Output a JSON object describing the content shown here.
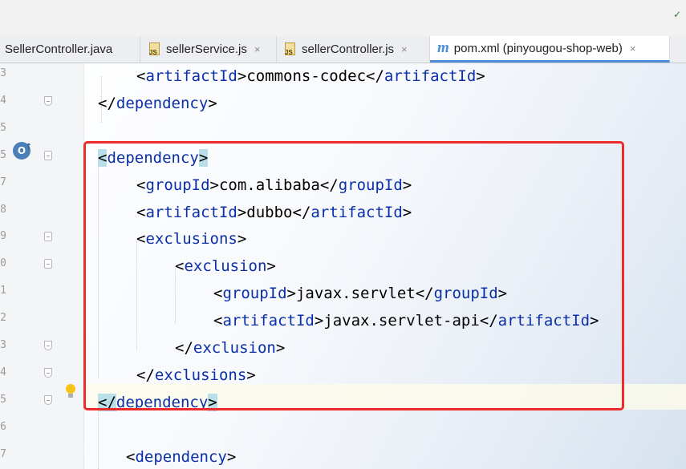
{
  "window": {
    "control_glyph": "✓"
  },
  "tabs": [
    {
      "label": "SellerController.java",
      "icon": "java-class-icon",
      "closable": false
    },
    {
      "label": "sellerService.js",
      "icon": "js-file-icon",
      "closable": true
    },
    {
      "label": "sellerController.js",
      "icon": "js-file-icon",
      "closable": true
    },
    {
      "label": "pom.xml (pinyougou-shop-web)",
      "icon": "maven-icon",
      "closable": true,
      "active": true
    }
  ],
  "tab_icon_text": {
    "js": "JS",
    "maven": "m"
  },
  "close_glyph": "×",
  "gutter": {
    "line_numbers": [
      "3",
      "4",
      "5",
      "5",
      "7",
      "8",
      "9",
      "0",
      "1",
      "2",
      "3",
      "4",
      "5",
      "6",
      "7"
    ],
    "override_glyph": "O",
    "override_arrow": "↑"
  },
  "code": [
    {
      "open": "<",
      "name": "artifactId",
      "close": ">",
      "text": "commons-codec",
      "end_open": "</",
      "end_name": "artifactId",
      "end_close": ">"
    },
    {
      "open": "</",
      "name": "dependency",
      "close": ">"
    },
    {},
    {
      "open": "<",
      "name": "dependency",
      "close": ">"
    },
    {
      "open": "<",
      "name": "groupId",
      "close": ">",
      "text": "com.alibaba",
      "end_open": "</",
      "end_name": "groupId",
      "end_close": ">"
    },
    {
      "open": "<",
      "name": "artifactId",
      "close": ">",
      "text": "dubbo",
      "end_open": "</",
      "end_name": "artifactId",
      "end_close": ">"
    },
    {
      "open": "<",
      "name": "exclusions",
      "close": ">"
    },
    {
      "open": "<",
      "name": "exclusion",
      "close": ">"
    },
    {
      "open": "<",
      "name": "groupId",
      "close": ">",
      "text": "javax.servlet",
      "end_open": "</",
      "end_name": "groupId",
      "end_close": ">"
    },
    {
      "open": "<",
      "name": "artifactId",
      "close": ">",
      "text": "javax.servlet-api",
      "end_open": "</",
      "end_name": "artifactId",
      "end_close": ">"
    },
    {
      "open": "</",
      "name": "exclusion",
      "close": ">"
    },
    {
      "open": "</",
      "name": "exclusions",
      "close": ">"
    },
    {
      "open": "</",
      "name": "dependency",
      "close": ">"
    },
    {},
    {
      "open": "<",
      "name": "dependency",
      "close": ">"
    }
  ],
  "colors": {
    "tag": "#0a2fa8",
    "active_tab_underline": "#4a8fd6",
    "highlight_box": "#ee2b2b",
    "brace_match": "#b9e0ea"
  }
}
